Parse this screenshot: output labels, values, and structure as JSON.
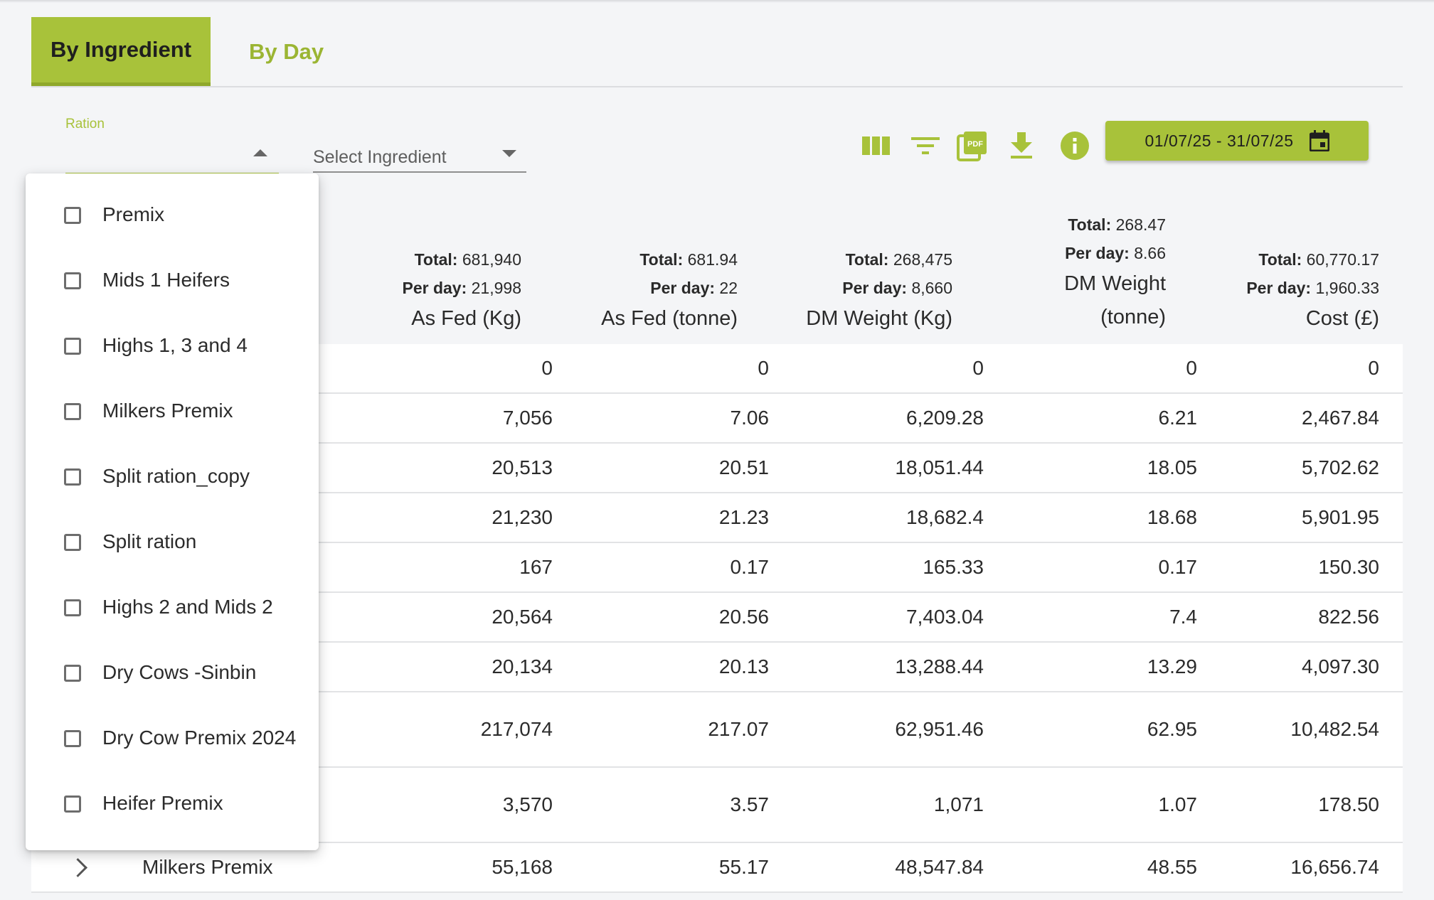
{
  "tabs": [
    {
      "label": "By Ingredient",
      "active": true
    },
    {
      "label": "By Day",
      "active": false
    }
  ],
  "filters": {
    "ration_label": "Ration",
    "ingredient_placeholder": "Select Ingredient"
  },
  "toolbar": {
    "icons": [
      "columns-icon",
      "filter-icon",
      "pdf-icon",
      "download-icon",
      "info-icon",
      "calendar-icon"
    ],
    "date_range": "01/07/25 - 31/07/25"
  },
  "colors": {
    "accent": "#a8c23a",
    "accent_text": "#9bb533"
  },
  "columns": [
    {
      "title": "As Fed (Kg)",
      "total_label": "Total:",
      "total": "681,940",
      "perday_label": "Per day:",
      "perday": "21,998"
    },
    {
      "title": "As Fed (tonne)",
      "total_label": "Total:",
      "total": "681.94",
      "perday_label": "Per day:",
      "perday": "22"
    },
    {
      "title": "DM Weight (Kg)",
      "total_label": "Total:",
      "total": "268,475",
      "perday_label": "Per day:",
      "perday": "8,660"
    },
    {
      "title_line1": "DM Weight",
      "title_line2": "(tonne)",
      "total_label": "Total:",
      "total": "268.47",
      "perday_label": "Per day:",
      "perday": "8.66"
    },
    {
      "title": "Cost (£)",
      "total_label": "Total:",
      "total": "60,770.17",
      "perday_label": "Per day:",
      "perday": "1,960.33"
    }
  ],
  "rows": [
    {
      "name": "",
      "values": [
        "0",
        "0",
        "0",
        "0",
        "0"
      ]
    },
    {
      "name": "",
      "values": [
        "7,056",
        "7.06",
        "6,209.28",
        "6.21",
        "2,467.84"
      ]
    },
    {
      "name": "",
      "values": [
        "20,513",
        "20.51",
        "18,051.44",
        "18.05",
        "5,702.62"
      ]
    },
    {
      "name": "",
      "values": [
        "21,230",
        "21.23",
        "18,682.4",
        "18.68",
        "5,901.95"
      ]
    },
    {
      "name": "",
      "values": [
        "167",
        "0.17",
        "165.33",
        "0.17",
        "150.30"
      ]
    },
    {
      "name": "",
      "values": [
        "20,564",
        "20.56",
        "7,403.04",
        "7.4",
        "822.56"
      ]
    },
    {
      "name": "",
      "values": [
        "20,134",
        "20.13",
        "13,288.44",
        "13.29",
        "4,097.30"
      ]
    },
    {
      "name": "",
      "values": [
        "217,074",
        "217.07",
        "62,951.46",
        "62.95",
        "10,482.54"
      ]
    },
    {
      "name": "",
      "values": [
        "3,570",
        "3.57",
        "1,071",
        "1.07",
        "178.50"
      ]
    },
    {
      "name": "Milkers Premix",
      "values": [
        "55,168",
        "55.17",
        "48,547.84",
        "48.55",
        "16,656.74"
      ]
    }
  ],
  "ration_options": [
    {
      "label": "Premix",
      "checked": false
    },
    {
      "label": "Mids 1 Heifers",
      "checked": false
    },
    {
      "label": "Highs 1, 3 and 4",
      "checked": false
    },
    {
      "label": "Milkers Premix",
      "checked": false
    },
    {
      "label": "Split ration_copy",
      "checked": false
    },
    {
      "label": "Split ration",
      "checked": false
    },
    {
      "label": "Highs 2 and Mids 2",
      "checked": false
    },
    {
      "label": "Dry Cows -Sinbin",
      "checked": false
    },
    {
      "label": "Dry Cow Premix 2024",
      "checked": false
    },
    {
      "label": "Heifer Premix",
      "checked": false
    }
  ]
}
